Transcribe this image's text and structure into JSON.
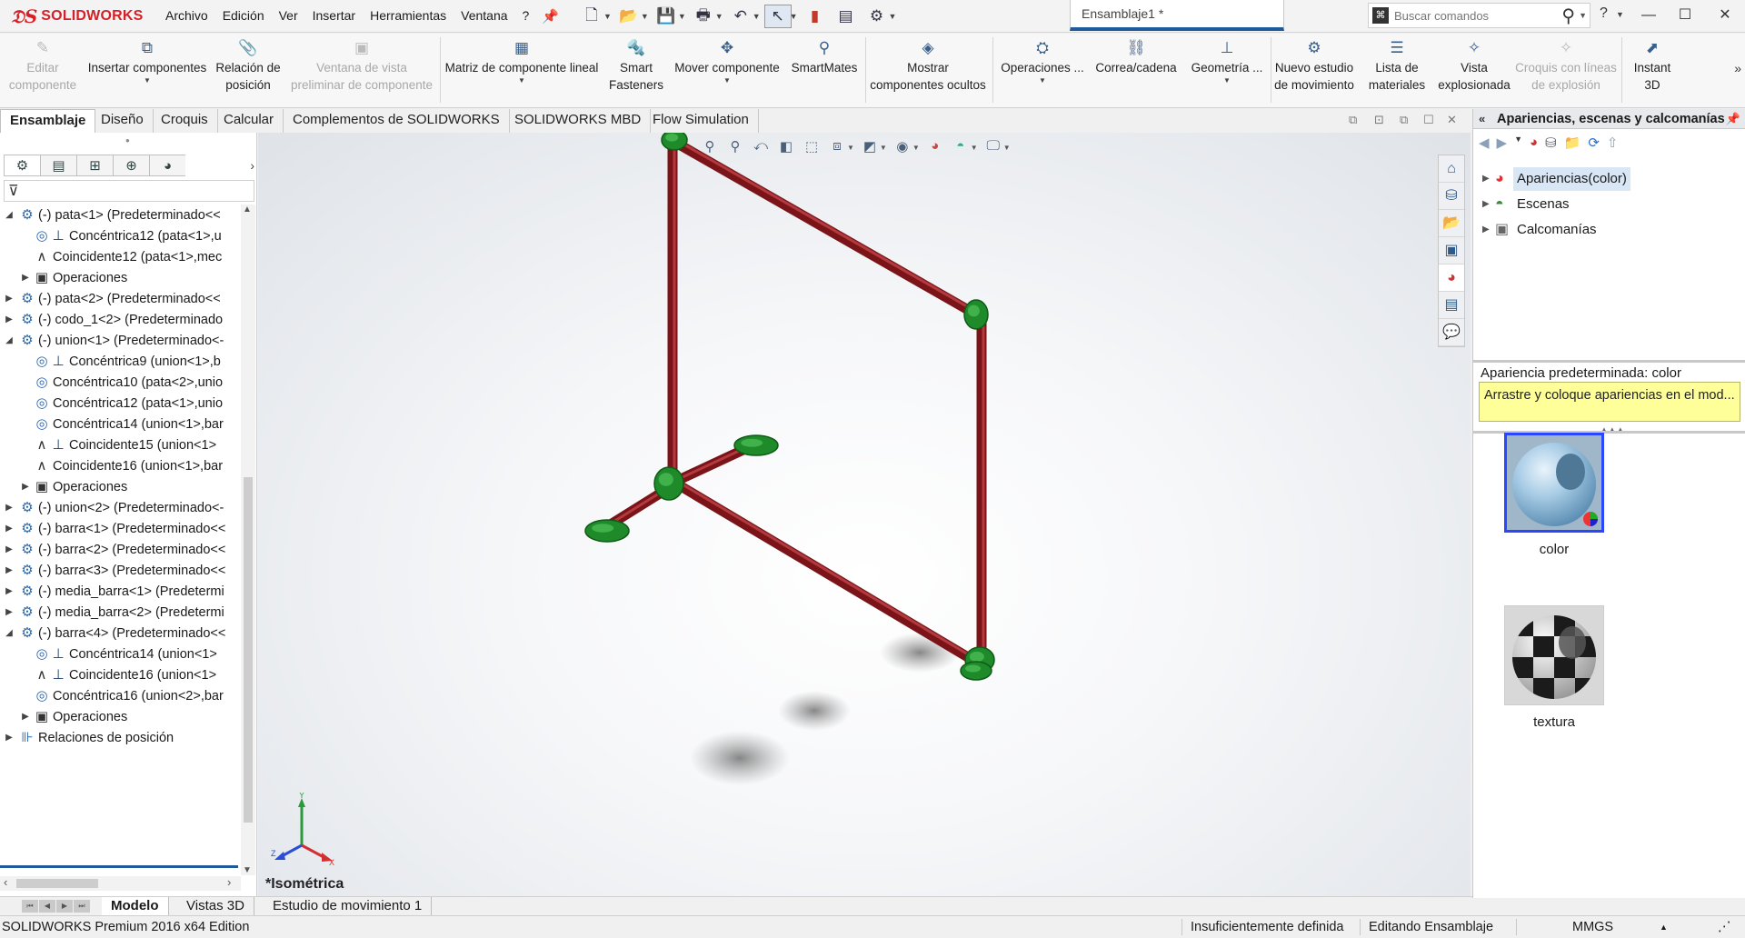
{
  "app": {
    "logo_text": "SOLIDWORKS",
    "document_tab": "Ensamblaje1 *"
  },
  "menu": [
    "Archivo",
    "Edición",
    "Ver",
    "Insertar",
    "Herramientas",
    "Ventana",
    "?"
  ],
  "search": {
    "placeholder": "Buscar comandos"
  },
  "window_controls": [
    "?",
    "—",
    "☐",
    "✕"
  ],
  "commands": [
    {
      "l1": "Editar",
      "l2": "componente",
      "disabled": true,
      "icon": "edit-component-icon"
    },
    {
      "l1": "Insertar componentes",
      "l2": "",
      "disabled": false,
      "icon": "insert-components-icon"
    },
    {
      "l1": "Relación de",
      "l2": "posición",
      "disabled": false,
      "icon": "mate-icon"
    },
    {
      "l1": "Ventana de vista",
      "l2": "preliminar de componente",
      "disabled": true,
      "icon": "preview-window-icon"
    },
    {
      "l1": "Matriz de componente lineal",
      "l2": "",
      "disabled": false,
      "icon": "linear-pattern-icon"
    },
    {
      "l1": "Smart",
      "l2": "Fasteners",
      "disabled": false,
      "icon": "smart-fasteners-icon"
    },
    {
      "l1": "Mover componente",
      "l2": "",
      "disabled": false,
      "icon": "move-component-icon"
    },
    {
      "l1": "SmartMates",
      "l2": "",
      "disabled": false,
      "icon": "smartmates-icon"
    },
    {
      "l1": "Mostrar",
      "l2": "componentes ocultos",
      "disabled": false,
      "icon": "show-hidden-icon"
    },
    {
      "l1": "Operaciones ...",
      "l2": "",
      "disabled": false,
      "icon": "assembly-features-icon"
    },
    {
      "l1": "Correa/cadena",
      "l2": "",
      "disabled": false,
      "icon": "belt-chain-icon"
    },
    {
      "l1": "Geometría ...",
      "l2": "",
      "disabled": false,
      "icon": "reference-geometry-icon"
    },
    {
      "l1": "Nuevo estudio",
      "l2": "de movimiento",
      "disabled": false,
      "icon": "motion-study-icon"
    },
    {
      "l1": "Lista de",
      "l2": "materiales",
      "disabled": false,
      "icon": "bom-icon"
    },
    {
      "l1": "Vista",
      "l2": "explosionada",
      "disabled": false,
      "icon": "exploded-view-icon"
    },
    {
      "l1": "Croquis con líneas",
      "l2": "de explosión",
      "disabled": true,
      "icon": "explode-line-sketch-icon"
    },
    {
      "l1": "Instant",
      "l2": "3D",
      "disabled": false,
      "icon": "instant3d-icon"
    }
  ],
  "tabs": [
    "Ensamblaje",
    "Diseño",
    "Croquis",
    "Calcular",
    "Complementos de SOLIDWORKS",
    "SOLIDWORKS MBD",
    "Flow Simulation"
  ],
  "tree": [
    {
      "level": 0,
      "twisty": "open",
      "icon": "component",
      "text": "(-) pata<1> (Predeterminado<<"
    },
    {
      "level": 1,
      "twisty": "",
      "icon": "concentric",
      "icon2": true,
      "text": "Concéntrica12 (pata<1>,u"
    },
    {
      "level": 1,
      "twisty": "",
      "icon": "coincident",
      "icon2": false,
      "text": "Coincidente12 (pata<1>,mec"
    },
    {
      "level": 1,
      "twisty": "closed",
      "icon": "ops",
      "icon2": false,
      "text": "Operaciones"
    },
    {
      "level": 0,
      "twisty": "closed",
      "icon": "component",
      "text": "(-) pata<2> (Predeterminado<<"
    },
    {
      "level": 0,
      "twisty": "closed",
      "icon": "component",
      "text": "(-) codo_1<2> (Predeterminado"
    },
    {
      "level": 0,
      "twisty": "open",
      "icon": "component",
      "text": "(-) union<1> (Predeterminado<-"
    },
    {
      "level": 1,
      "twisty": "",
      "icon": "concentric",
      "icon2": true,
      "text": "Concéntrica9 (union<1>,b"
    },
    {
      "level": 1,
      "twisty": "",
      "icon": "concentric",
      "icon2": false,
      "text": "Concéntrica10 (pata<2>,unio"
    },
    {
      "level": 1,
      "twisty": "",
      "icon": "concentric",
      "icon2": false,
      "text": "Concéntrica12 (pata<1>,unio"
    },
    {
      "level": 1,
      "twisty": "",
      "icon": "concentric",
      "icon2": false,
      "text": "Concéntrica14 (union<1>,bar"
    },
    {
      "level": 1,
      "twisty": "",
      "icon": "coincident",
      "icon2": true,
      "text": "Coincidente15 (union<1>"
    },
    {
      "level": 1,
      "twisty": "",
      "icon": "coincident",
      "icon2": false,
      "text": "Coincidente16 (union<1>,bar"
    },
    {
      "level": 1,
      "twisty": "closed",
      "icon": "ops",
      "icon2": false,
      "text": "Operaciones"
    },
    {
      "level": 0,
      "twisty": "closed",
      "icon": "component",
      "text": "(-) union<2> (Predeterminado<-"
    },
    {
      "level": 0,
      "twisty": "closed",
      "icon": "component",
      "text": "(-) barra<1> (Predeterminado<<"
    },
    {
      "level": 0,
      "twisty": "closed",
      "icon": "component",
      "text": "(-) barra<2> (Predeterminado<<"
    },
    {
      "level": 0,
      "twisty": "closed",
      "icon": "component",
      "text": "(-) barra<3> (Predeterminado<<"
    },
    {
      "level": 0,
      "twisty": "closed",
      "icon": "component",
      "text": "(-) media_barra<1> (Predetermi"
    },
    {
      "level": 0,
      "twisty": "closed",
      "icon": "component",
      "text": "(-) media_barra<2> (Predetermi"
    },
    {
      "level": 0,
      "twisty": "open",
      "icon": "component",
      "text": "(-) barra<4> (Predeterminado<<"
    },
    {
      "level": 1,
      "twisty": "",
      "icon": "concentric",
      "icon2": true,
      "text": "Concéntrica14 (union<1>"
    },
    {
      "level": 1,
      "twisty": "",
      "icon": "coincident",
      "icon2": true,
      "text": "Coincidente16 (union<1>"
    },
    {
      "level": 1,
      "twisty": "",
      "icon": "concentric",
      "icon2": false,
      "text": "Concéntrica16 (union<2>,bar"
    },
    {
      "level": 1,
      "twisty": "closed",
      "icon": "ops",
      "icon2": false,
      "text": "Operaciones"
    },
    {
      "level": 0,
      "twisty": "closed",
      "icon": "mates",
      "text": "Relaciones de posición"
    }
  ],
  "viewport": {
    "view_name": "*Isométrica",
    "frame_color": "#7a1418",
    "connector_color": "#1f8a2a"
  },
  "task_pane": {
    "title": "Apariencias, escenas y calcomanías",
    "items": [
      {
        "label": "Apariencias(color)",
        "selected": true,
        "icon": "appearances-icon"
      },
      {
        "label": "Escenas",
        "selected": false,
        "icon": "scenes-icon"
      },
      {
        "label": "Calcomanías",
        "selected": false,
        "icon": "decals-icon"
      }
    ],
    "default_label": "Apariencia predeterminada: color",
    "tip": "Arrastre y coloque apariencias en el mod...",
    "swatches": [
      {
        "label": "color"
      },
      {
        "label": "textura"
      }
    ]
  },
  "bottom_tabs": [
    "Modelo",
    "Vistas 3D",
    "Estudio de movimiento 1"
  ],
  "status": {
    "product": "SOLIDWORKS Premium 2016 x64 Edition",
    "definition": "Insuficientemente definida",
    "mode": "Editando Ensamblaje",
    "units": "MMGS"
  }
}
